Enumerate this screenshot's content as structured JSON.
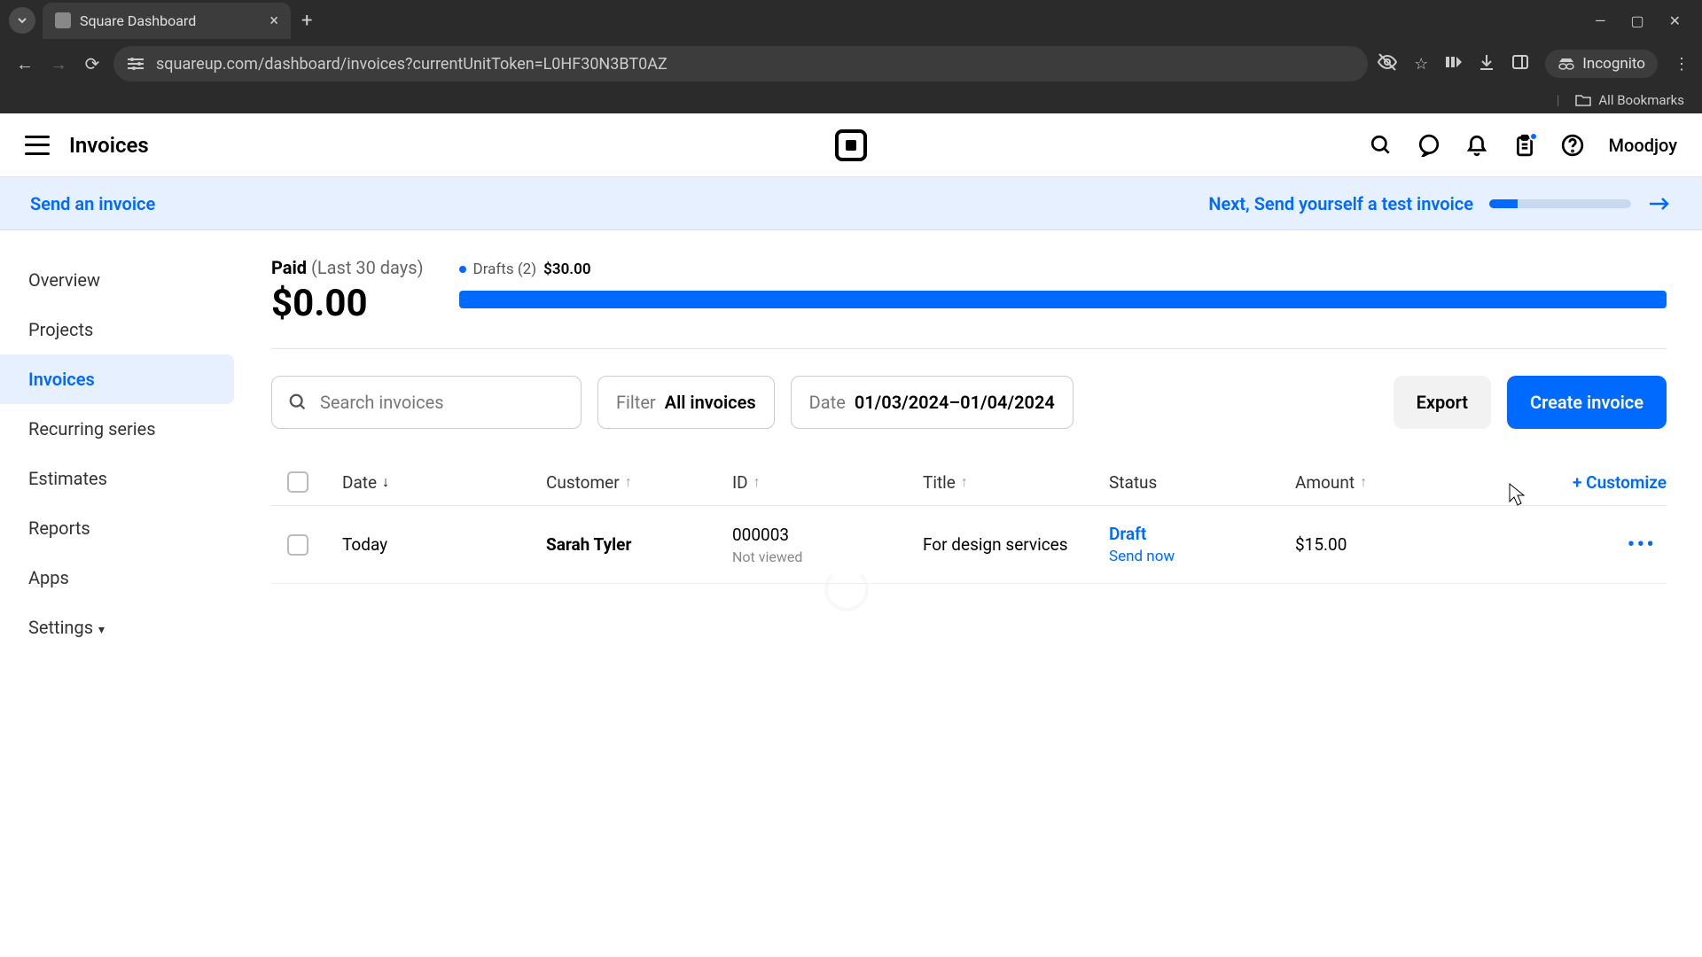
{
  "browser": {
    "tab_title": "Square Dashboard",
    "url": "squareup.com/dashboard/invoices?currentUnitToken=L0HF30N3BT0AZ",
    "incognito_label": "Incognito",
    "bookmarks_label": "All Bookmarks"
  },
  "header": {
    "title": "Invoices",
    "username": "Moodjoy"
  },
  "banner": {
    "left": "Send an invoice",
    "right": "Next, Send yourself a test invoice"
  },
  "sidebar": {
    "items": [
      {
        "label": "Overview"
      },
      {
        "label": "Projects"
      },
      {
        "label": "Invoices"
      },
      {
        "label": "Recurring series"
      },
      {
        "label": "Estimates"
      },
      {
        "label": "Reports"
      },
      {
        "label": "Apps"
      },
      {
        "label": "Settings"
      }
    ]
  },
  "stats": {
    "paid_label": "Paid",
    "period": "(Last 30 days)",
    "paid_amount": "$0.00",
    "drafts_label": "Drafts (2)",
    "drafts_amount": "$30.00"
  },
  "controls": {
    "search_placeholder": "Search invoices",
    "filter_label": "Filter",
    "filter_value": "All invoices",
    "date_label": "Date",
    "date_value": "01/03/2024–01/04/2024",
    "export": "Export",
    "create": "Create invoice"
  },
  "table": {
    "columns": {
      "date": "Date",
      "customer": "Customer",
      "id": "ID",
      "title": "Title",
      "status": "Status",
      "amount": "Amount",
      "customize": "+ Customize"
    },
    "rows": [
      {
        "date": "Today",
        "customer": "Sarah Tyler",
        "id": "000003",
        "id_sub": "Not viewed",
        "title": "For design services",
        "status": "Draft",
        "status_action": "Send now",
        "amount": "$15.00"
      }
    ]
  }
}
